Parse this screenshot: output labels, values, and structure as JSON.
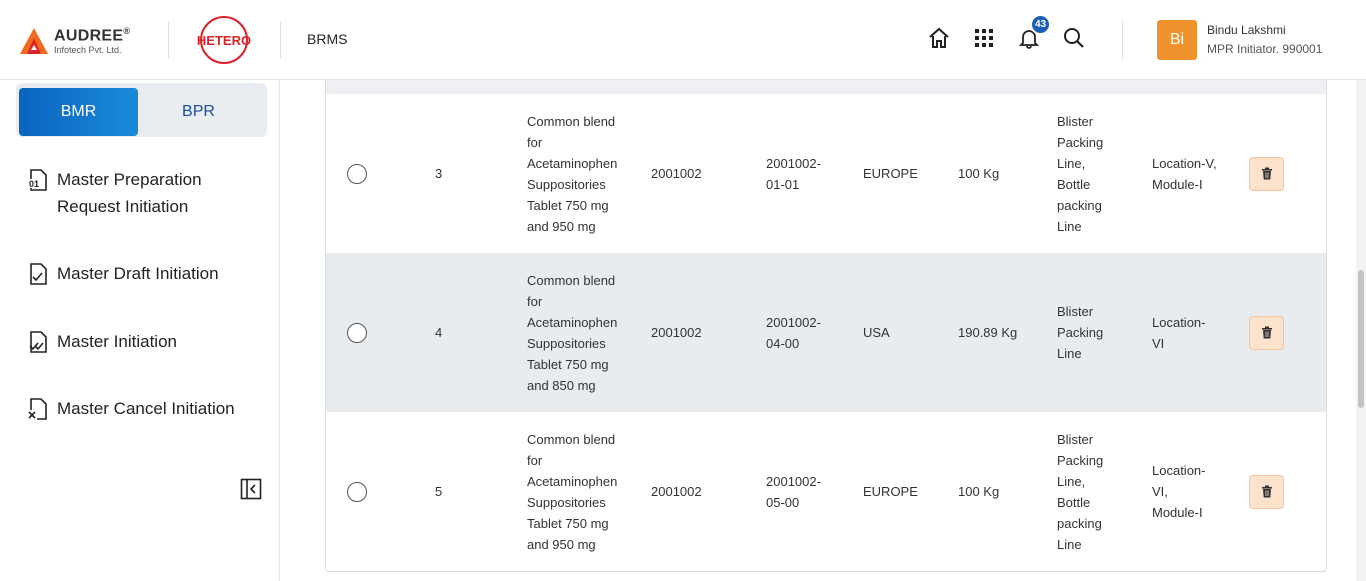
{
  "header": {
    "logo_brand": "AUDREE",
    "logo_reg": "®",
    "logo_sub": "Infotech Pvt. Ltd.",
    "partner_logo": "HETERO",
    "app_name": "BRMS",
    "notification_count": "43",
    "user": {
      "initials": "Bi",
      "name": "Bindu Lakshmi",
      "role": "MPR Initiator. 990001"
    },
    "icons": [
      "home-icon",
      "apps-grid-icon",
      "bell-icon",
      "search-icon"
    ]
  },
  "sidebar": {
    "tabs": [
      {
        "label": "BMR",
        "active": true
      },
      {
        "label": "BPR",
        "active": false
      }
    ],
    "items": [
      {
        "label_line1": "Master Preparation",
        "label_line2": "Request Initiation",
        "icon": "document-01-icon"
      },
      {
        "label": "Master Draft Initiation",
        "icon": "document-check-icon"
      },
      {
        "label": "Master Initiation",
        "icon": "document-double-check-icon"
      },
      {
        "label": "Master Cancel Initiation",
        "icon": "document-cancel-icon"
      }
    ]
  },
  "table": {
    "rows": [
      {
        "no": "3",
        "product": [
          "Common blend",
          "for",
          "Acetaminophen",
          "Suppositories",
          "Tablet 750 mg",
          "and 950 mg"
        ],
        "code": "2001002",
        "mpr": [
          "2001002-",
          "01-01"
        ],
        "market": "EUROPE",
        "batch_size": "100 Kg",
        "line": [
          "Blister",
          "Packing",
          "Line,",
          "Bottle",
          "packing",
          "Line"
        ],
        "location": [
          "Location-V,",
          "Module-I"
        ]
      },
      {
        "no": "4",
        "product": [
          "Common blend",
          "for",
          "Acetaminophen",
          "Suppositories",
          "Tablet 750 mg",
          "and 850 mg"
        ],
        "code": "2001002",
        "mpr": [
          "2001002-",
          "04-00"
        ],
        "market": "USA",
        "batch_size": "190.89 Kg",
        "line": [
          "Blister",
          "Packing",
          "Line"
        ],
        "location": [
          "Location-",
          "VI"
        ]
      },
      {
        "no": "5",
        "product": [
          "Common blend",
          "for",
          "Acetaminophen",
          "Suppositories",
          "Tablet 750 mg",
          "and 950 mg"
        ],
        "code": "2001002",
        "mpr": [
          "2001002-",
          "05-00"
        ],
        "market": "EUROPE",
        "batch_size": "100 Kg",
        "line": [
          "Blister",
          "Packing",
          "Line,",
          "Bottle",
          "packing",
          "Line"
        ],
        "location": [
          "Location-",
          "VI,",
          "Module-I"
        ]
      }
    ]
  },
  "colors": {
    "primary": "#0a64c0",
    "badge": "#1e5fb4",
    "avatar": "#f0922e",
    "delete_bg": "#fde3cc",
    "hetero_red": "#d8232a",
    "audree_orange": "#f26a21"
  }
}
